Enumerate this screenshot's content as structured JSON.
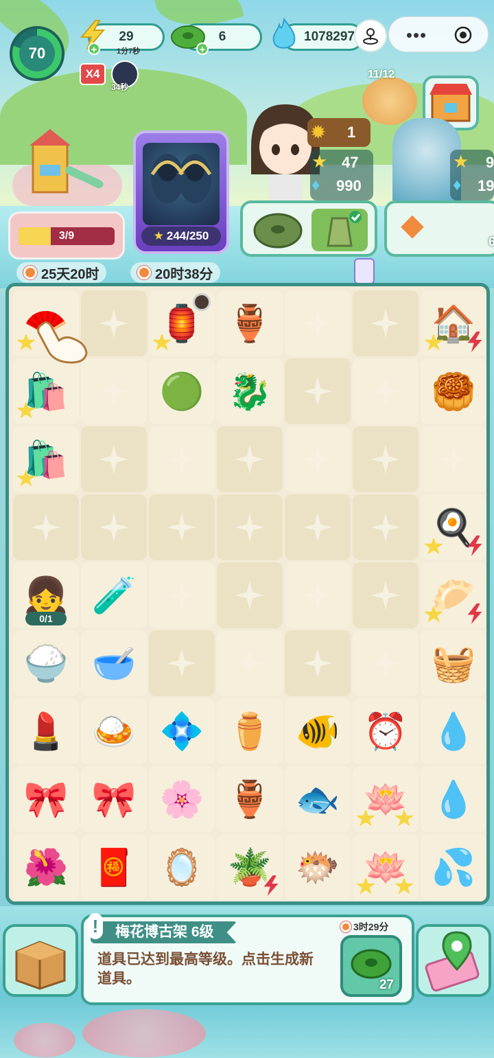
{
  "hud": {
    "level": "70",
    "energy": {
      "value": "29",
      "timer": "1分7秒"
    },
    "jade": {
      "value": "6"
    },
    "flame": {
      "value": "1078297"
    },
    "multiplier": "X4",
    "boost_timer": "34秒",
    "menu_icon": "more-dots",
    "record_icon": "target-circle"
  },
  "scene": {
    "playground_progress": {
      "label": "3/9",
      "fraction": 0.333
    },
    "event_timer_1": "25天20时",
    "event_timer_2": "20时38分",
    "hero_card": {
      "count": "244/250"
    },
    "character": {
      "sunflower_count": "1",
      "star_value": "47",
      "flame_value": "990"
    },
    "side_character": {
      "star_value": "9",
      "flame_value": "19"
    },
    "mini_avatar_count": "11/12",
    "right_card_count": "6"
  },
  "board": {
    "rows": [
      [
        {
          "name": "tool-stand-item",
          "icon": "🪭",
          "star": true
        },
        {
          "name": "empty"
        },
        {
          "name": "antique-shelf-item",
          "icon": "🏮",
          "star": true,
          "timer": true
        },
        {
          "name": "jade-vessel-item",
          "icon": "🏺"
        },
        {
          "name": "empty-lit"
        },
        {
          "name": "empty"
        },
        {
          "name": "shop-building-item",
          "icon": "🏠",
          "star": true,
          "bolt": true
        }
      ],
      [
        {
          "name": "gift-bags-item",
          "icon": "🛍️",
          "star": true
        },
        {
          "name": "empty-lit"
        },
        {
          "name": "jade-ring-piece-item",
          "icon": "🟢"
        },
        {
          "name": "jade-dragon-item",
          "icon": "🐉"
        },
        {
          "name": "empty"
        },
        {
          "name": "empty-lit"
        },
        {
          "name": "mooncake-item",
          "icon": "🥮"
        }
      ],
      [
        {
          "name": "gift-bags-item",
          "icon": "🛍️",
          "star": true
        },
        {
          "name": "empty"
        },
        {
          "name": "empty-lit"
        },
        {
          "name": "empty"
        },
        {
          "name": "empty-lit"
        },
        {
          "name": "empty"
        },
        {
          "name": "empty-lit"
        }
      ],
      [
        {
          "name": "empty"
        },
        {
          "name": "empty"
        },
        {
          "name": "empty"
        },
        {
          "name": "empty"
        },
        {
          "name": "empty"
        },
        {
          "name": "empty"
        },
        {
          "name": "kitchen-stall-item",
          "icon": "🍳",
          "star": true,
          "bolt": true
        }
      ],
      [
        {
          "name": "customer-girl-item",
          "icon": "👧",
          "count": "0/1"
        },
        {
          "name": "potion-bottle-item",
          "icon": "🧪"
        },
        {
          "name": "empty-lit"
        },
        {
          "name": "empty"
        },
        {
          "name": "empty-lit"
        },
        {
          "name": "empty"
        },
        {
          "name": "steamer-dumpling-item",
          "icon": "🥟",
          "star": true,
          "bolt": true
        }
      ],
      [
        {
          "name": "rice-bowl-item",
          "icon": "🍚"
        },
        {
          "name": "porridge-bowl-item",
          "icon": "🥣"
        },
        {
          "name": "empty"
        },
        {
          "name": "empty-lit"
        },
        {
          "name": "empty"
        },
        {
          "name": "empty-lit"
        },
        {
          "name": "steamer-stack-item",
          "icon": "🧺"
        }
      ],
      [
        {
          "name": "lipstick-item",
          "icon": "💄"
        },
        {
          "name": "fried-rice-item",
          "icon": "🍛"
        },
        {
          "name": "hairpin-item",
          "icon": "💠"
        },
        {
          "name": "celadon-vase-item",
          "icon": "⚱️"
        },
        {
          "name": "goldfish-item",
          "icon": "🐠"
        },
        {
          "name": "alarm-clock-item",
          "icon": "⏰"
        },
        {
          "name": "blue-flame-item",
          "icon": "💧"
        }
      ],
      [
        {
          "name": "chinese-knot-item",
          "icon": "🎀"
        },
        {
          "name": "chinese-knot-item",
          "icon": "🎀"
        },
        {
          "name": "pearl-hairpin-item",
          "icon": "🌸"
        },
        {
          "name": "porcelain-vase-item",
          "icon": "🏺"
        },
        {
          "name": "betta-fish-item",
          "icon": "🐟"
        },
        {
          "name": "lotus-flowers-item",
          "icon": "🪷",
          "star": true,
          "star2": true
        },
        {
          "name": "blue-flame-item",
          "icon": "💧"
        }
      ],
      [
        {
          "name": "red-flower-knot-item",
          "icon": "🌺"
        },
        {
          "name": "embroidered-pouch-item",
          "icon": "🧧"
        },
        {
          "name": "compact-mirror-item",
          "icon": "🪞"
        },
        {
          "name": "lotus-pond-item",
          "icon": "🪴",
          "bolt": true
        },
        {
          "name": "fancy-goldfish-item",
          "icon": "🐡"
        },
        {
          "name": "lotus-flowers-item",
          "icon": "🪷",
          "star": true,
          "star2": true
        },
        {
          "name": "twin-flame-item",
          "icon": "💦"
        }
      ]
    ]
  },
  "info_panel": {
    "title": "梅花博古架 6级",
    "description": "道具已达到最高等级。点击生成新道具。",
    "produce_timer": "3时29分",
    "produce_count": "27"
  }
}
